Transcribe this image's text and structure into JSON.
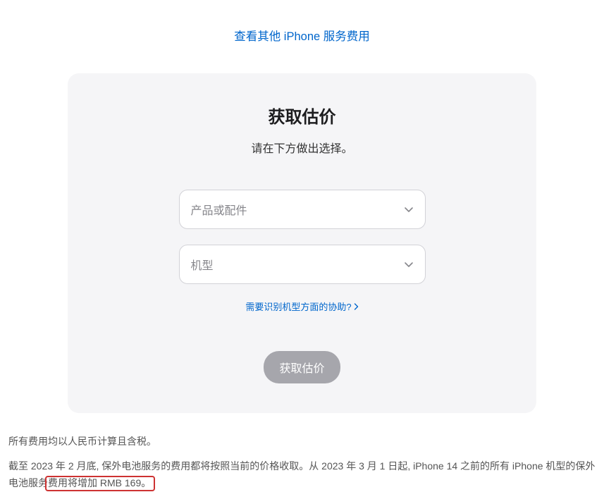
{
  "topLink": "查看其他 iPhone 服务费用",
  "card": {
    "title": "获取估价",
    "subtitle": "请在下方做出选择。",
    "select1Placeholder": "产品或配件",
    "select2Placeholder": "机型",
    "helpLink": "需要识别机型方面的协助?",
    "submitLabel": "获取估价"
  },
  "footer": {
    "line1": "所有费用均以人民币计算且含税。",
    "line2_part1": "截至 2023 年 2 月底, 保外电池服务的费用都将按照当前的价格收取。从 2023 年 3 月 1 日起, iPhone 14 之前的所有 iPhone 机型的保外电池服务",
    "line2_highlight": "费用将增加 RMB 169。"
  }
}
